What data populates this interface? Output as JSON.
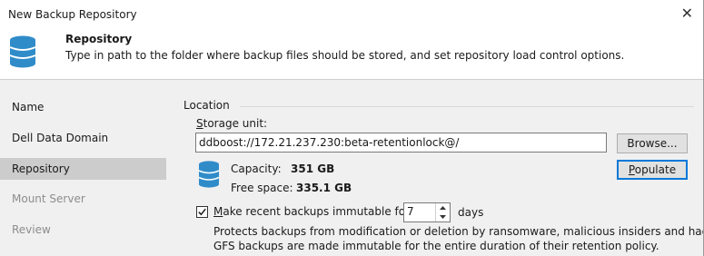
{
  "window": {
    "title": "New Backup Repository"
  },
  "header": {
    "icon": "database-icon",
    "title": "Repository",
    "description": "Type in path to the folder where backup files should be stored, and set repository load control options."
  },
  "sidebar": {
    "items": [
      {
        "label": "Name",
        "state": "normal"
      },
      {
        "label": "Dell Data Domain",
        "state": "normal"
      },
      {
        "label": "Repository",
        "state": "active"
      },
      {
        "label": "Mount Server",
        "state": "disabled"
      },
      {
        "label": "Review",
        "state": "disabled"
      }
    ]
  },
  "location": {
    "group_label": "Location",
    "storage_label_access": "S",
    "storage_label_rest": "torage unit:",
    "path_value": "ddboost://172.21.237.230:beta-retentionlock@/",
    "browse_label": "Browse...",
    "populate_access": "P",
    "populate_rest": "opulate",
    "capacity_label": "Capacity:",
    "capacity_value": "351 GB",
    "free_label": "Free space:",
    "free_value": "335.1 GB"
  },
  "immutability": {
    "checked": true,
    "label_access": "M",
    "label_rest": "ake recent backups immutable for:",
    "days_value": "7",
    "days_label": "days",
    "description_line1": "Protects backups from modification or deletion by ransomware, malicious insiders and hackers.",
    "description_line2": "GFS backups are made immutable for the entire duration of their retention policy."
  },
  "colors": {
    "accent": "#0078d7",
    "db_icon": "#2f8cc9",
    "sidebar_bg": "#f0f0f0",
    "active_item_bg": "#cccccc"
  }
}
